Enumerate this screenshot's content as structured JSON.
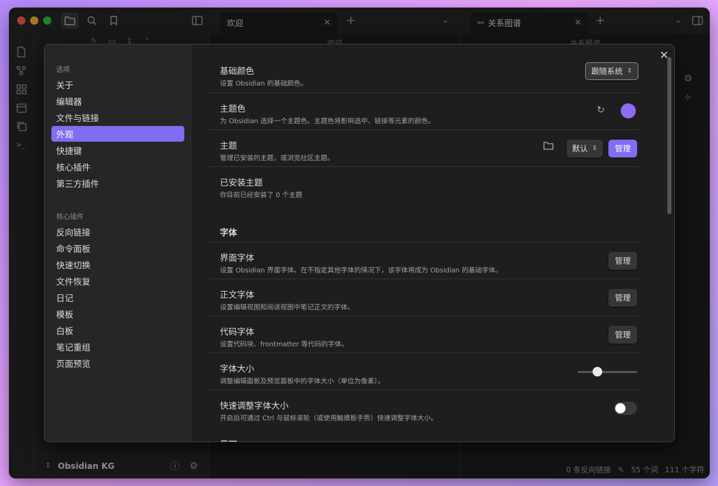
{
  "titlebar": {
    "tab_welcome": "欢迎",
    "tab_graph": "关系图谱"
  },
  "panes": {
    "welcome_header": "欢迎",
    "graph_header": "关系图谱"
  },
  "vault": {
    "name": "Obsidian KG"
  },
  "status_bar": {
    "backlinks": "0 条反向链接",
    "words": "55 个词",
    "chars": "111 个字符"
  },
  "sidebar": {
    "heading_options": "选项",
    "options": [
      "关于",
      "编辑器",
      "文件与链接",
      "外观",
      "快捷键",
      "核心插件",
      "第三方插件"
    ],
    "active_index": 3,
    "heading_core": "核心插件",
    "core": [
      "反向链接",
      "命令面板",
      "快速切换",
      "文件恢复",
      "日记",
      "模板",
      "白板",
      "笔记重组",
      "页面预览"
    ]
  },
  "settings": {
    "base_color": {
      "title": "基础颜色",
      "desc": "设置 Obsidian 的基础颜色。",
      "value": "跟随系统"
    },
    "accent_color": {
      "title": "主题色",
      "desc": "为 Obsidian 选择一个主题色。主题色将影响选中、链接等元素的颜色。",
      "color": "#8c6cf2"
    },
    "theme": {
      "title": "主题",
      "desc": "管理已安装的主题，或浏览社区主题。",
      "value": "默认",
      "manage": "管理"
    },
    "installed": {
      "title": "已安装主题",
      "desc": "你目前已经安装了 0 个主题"
    },
    "font_section": "字体",
    "interface_font": {
      "title": "界面字体",
      "desc": "设置 Obsidian 界面字体。在不指定其他字体的情况下，该字体将成为 Obsidian 的基础字体。",
      "manage": "管理"
    },
    "text_font": {
      "title": "正文字体",
      "desc": "设置编辑视图和阅读视图中笔记正文的字体。",
      "manage": "管理"
    },
    "code_font": {
      "title": "代码字体",
      "desc": "设置代码块、frontmatter 等代码的字体。",
      "manage": "管理"
    },
    "font_size": {
      "title": "字体大小",
      "desc": "调整编辑面板及预览面板中的字体大小（单位为像素）。",
      "slider_fraction": 0.33
    },
    "quick_font": {
      "title": "快速调整字体大小",
      "desc": "开启后可通过 Ctrl 与鼠标滚轮（或使用触摸板手势）快速调整字体大小。",
      "enabled": false
    },
    "interface_section": "界面"
  },
  "colors": {
    "accent": "#7f6df2"
  }
}
